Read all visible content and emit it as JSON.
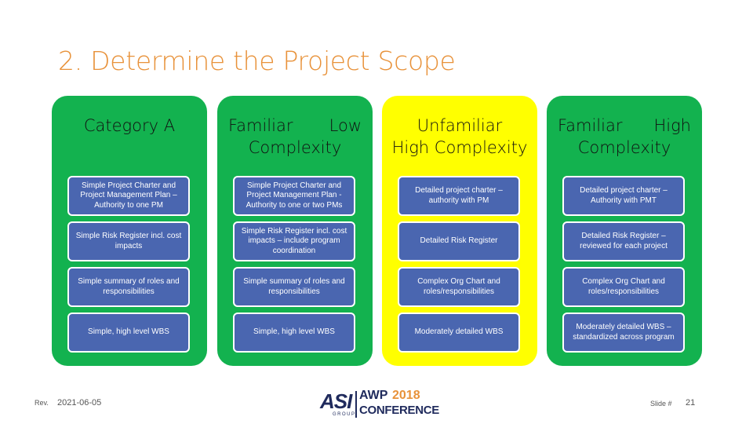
{
  "slide": {
    "title": "2. Determine the Project Scope",
    "colors": {
      "title": "#e8923a",
      "green_panel": "#13b24f",
      "yellow_panel": "#ffff00",
      "card": "#4a66b0",
      "card_text": "#ffffff"
    },
    "columns": [
      {
        "heading_line1": "Category A",
        "heading_line2": "",
        "color": "green",
        "items": [
          "Simple Project Charter and Project Management Plan – Authority to one PM",
          "Simple Risk Register incl. cost impacts",
          "Simple summary of roles and responsibilities",
          "Simple, high level WBS"
        ]
      },
      {
        "heading_line1a": "Familiar",
        "heading_line1b": "Low",
        "heading_line2": "Complexity",
        "color": "green",
        "items": [
          "Simple Project Charter and Project Management Plan - Authority to one or two PMs",
          "Simple Risk Register incl. cost impacts – include program coordination",
          "Simple summary of roles and responsibilities",
          "Simple, high level WBS"
        ]
      },
      {
        "heading_line1": "Unfamiliar",
        "heading_line2": "High Complexity",
        "color": "yellow",
        "items": [
          "Detailed project charter – authority with PM",
          "Detailed Risk Register",
          "Complex Org Chart and roles/responsibilities",
          "Moderately detailed WBS"
        ]
      },
      {
        "heading_line1a": "Familiar",
        "heading_line1b": "High",
        "heading_line2": "Complexity",
        "color": "green",
        "items": [
          "Detailed project charter – Authority with PMT",
          "Detailed Risk Register – reviewed for each project",
          "Complex Org Chart and roles/responsibilities",
          "Moderately detailed WBS – standardized across program"
        ]
      }
    ]
  },
  "footer": {
    "rev_label": "Rev.",
    "rev_date": "2021-06-05",
    "slide_label": "Slide #",
    "slide_number": "21",
    "logo": {
      "asi": "ASI",
      "group": "GROUP",
      "awp": "AWP",
      "year": "2018",
      "conference": "CONFERENCE"
    }
  }
}
